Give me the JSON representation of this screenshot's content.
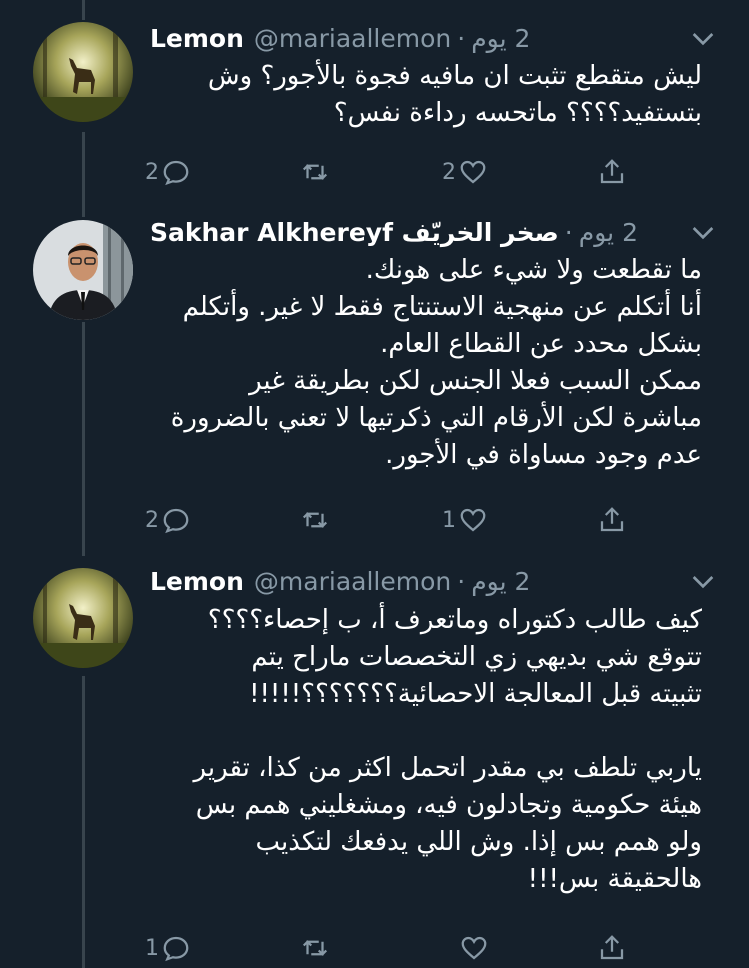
{
  "tweets": [
    {
      "name": "Lemon",
      "handle": "@mariaallemon",
      "time": "2 يوم",
      "lines": [
        "ليش متقطع تثبت ان مافيه فجوة بالأجور؟ وش",
        "بتستفيد؟؟؟؟ ماتحسه رداءة نفس؟"
      ],
      "replies": "2",
      "retweets": "",
      "likes": "2",
      "avatar": "deer-in-forest-avatar"
    },
    {
      "name": "Sakhar Alkhereyf صخر الخريّف",
      "handle": "",
      "time": "2 يوم",
      "lines": [
        "ما تقطعت ولا شيء على هونك.",
        "أنا أتكلم عن منهجية الاستنتاج فقط لا غير. وأتكلم",
        "بشكل محدد عن القطاع العام.",
        "ممكن السبب فعلا الجنس لكن بطريقة غير",
        "مباشرة لكن الأرقام التي ذكرتيها لا تعني بالضرورة",
        "عدم وجود مساواة في الأجور."
      ],
      "replies": "2",
      "retweets": "",
      "likes": "1",
      "avatar": "man-in-suit-avatar"
    },
    {
      "name": "Lemon",
      "handle": "@mariaallemon",
      "time": "2 يوم",
      "lines": [
        "كيف طالب دكتوراه وماتعرف أ، ب إحصاء؟؟؟؟",
        "تتوقع شي بديهي زي التخصصات ماراح يتم",
        "تثبيته قبل المعالجة الاحصائية؟؟؟؟؟؟؟!!!!!",
        "",
        "ياربي تلطف بي مقدر اتحمل اكثر من كذا، تقرير",
        "هيئة حكومية وتجادلون فيه، ومشغليني همم بس",
        "ولو همم بس إذا. وش اللي يدفعك لتكذيب",
        "هالحقيقة بس!!!"
      ],
      "replies": "1",
      "retweets": "",
      "likes": "",
      "avatar": "deer-in-forest-avatar"
    }
  ],
  "colors": {
    "background": "#15202b",
    "secondary_text": "#8899a6",
    "thread_line": "#38444d"
  }
}
